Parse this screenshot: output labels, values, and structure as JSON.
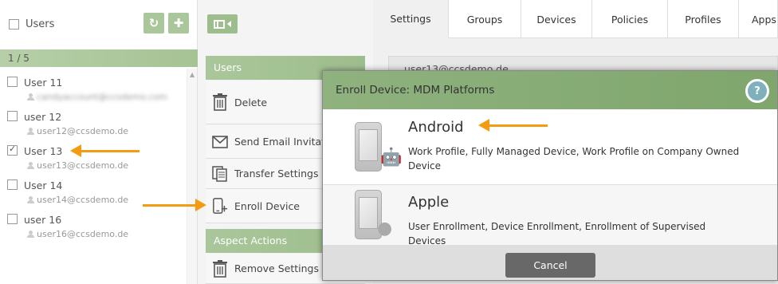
{
  "users_panel": {
    "title": "Users",
    "counter": "1 / 5",
    "users": [
      {
        "name": "User 11",
        "email": "candyaccount@ccsdemo.com",
        "checked": false,
        "blurred": true
      },
      {
        "name": "user 12",
        "email": "user12@ccsdemo.de",
        "checked": false,
        "blurred": false
      },
      {
        "name": "User 13",
        "email": "user13@ccsdemo.de",
        "checked": true,
        "blurred": false
      },
      {
        "name": "User 14",
        "email": "user14@ccsdemo.de",
        "checked": false,
        "blurred": false
      },
      {
        "name": "user 16",
        "email": "user16@ccsdemo.de",
        "checked": false,
        "blurred": false
      }
    ]
  },
  "actions_panel": {
    "users_section": "Users",
    "delete": "Delete",
    "send_email": "Send Email Invitation",
    "transfer": "Transfer Settings",
    "enroll": "Enroll Device",
    "aspect_section": "Aspect Actions",
    "remove_settings": "Remove Settings"
  },
  "tabs": [
    "Settings",
    "Groups",
    "Devices",
    "Policies",
    "Profiles",
    "Apps"
  ],
  "selected_user_email": "user13@ccsdemo.de",
  "dialog": {
    "title": "Enroll Device: MDM Platforms",
    "help": "?",
    "android": {
      "title": "Android",
      "description": "Work Profile, Fully Managed Device, Work Profile on Company Owned Device"
    },
    "apple": {
      "title": "Apple",
      "description": "User Enrollment, Device Enrollment, Enrollment of Supervised Devices"
    },
    "cancel": "Cancel"
  },
  "colors": {
    "accent_green": "#9ebd8d",
    "dialog_header": "#8fb27e",
    "arrow": "#f39c12",
    "cancel_button": "#686868"
  },
  "icons": [
    "refresh-icon",
    "plus-icon",
    "panel-toggle-icon",
    "trash-icon",
    "envelope-icon",
    "transfer-document-icon",
    "enroll-device-icon",
    "help-icon",
    "android-phone-icon",
    "apple-phone-icon"
  ]
}
